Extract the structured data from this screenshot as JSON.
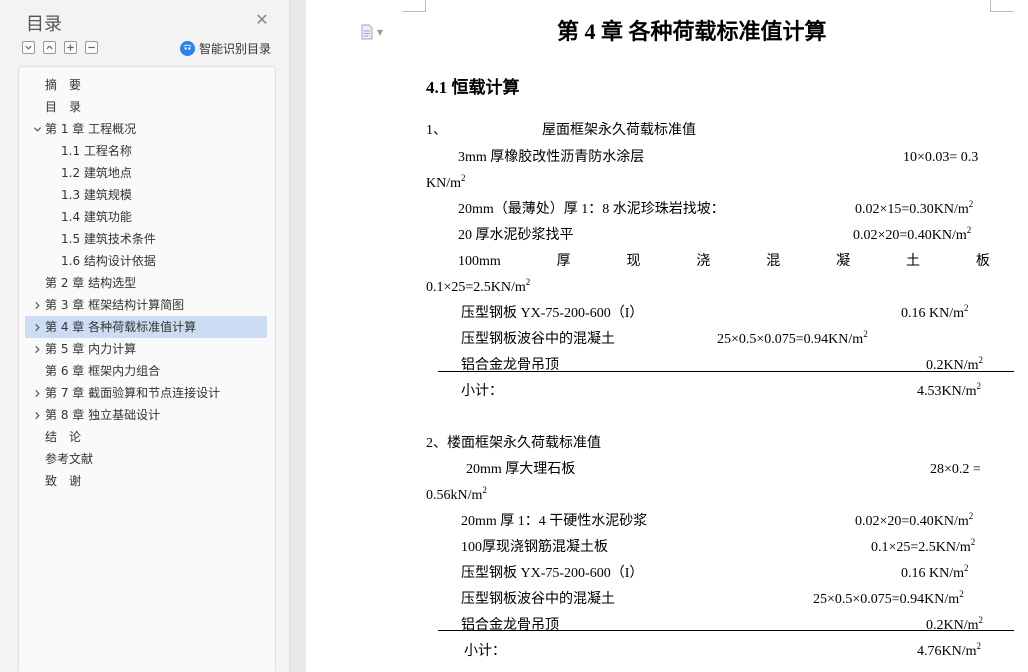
{
  "toc": {
    "title": "目录",
    "smart_label": "智能识别目录",
    "items": [
      {
        "label": "摘　要",
        "level": 0,
        "chevron": "none",
        "selected": false
      },
      {
        "label": "目　录",
        "level": 0,
        "chevron": "none",
        "selected": false
      },
      {
        "label": "第 1 章  工程概况",
        "level": 0,
        "chevron": "down",
        "selected": false
      },
      {
        "label": "1.1 工程名称",
        "level": 1,
        "chevron": "none",
        "selected": false
      },
      {
        "label": "1.2 建筑地点",
        "level": 1,
        "chevron": "none",
        "selected": false
      },
      {
        "label": "1.3 建筑规模",
        "level": 1,
        "chevron": "none",
        "selected": false
      },
      {
        "label": "1.4 建筑功能",
        "level": 1,
        "chevron": "none",
        "selected": false
      },
      {
        "label": "1.5 建筑技术条件",
        "level": 1,
        "chevron": "none",
        "selected": false
      },
      {
        "label": "1.6 结构设计依据",
        "level": 1,
        "chevron": "none",
        "selected": false
      },
      {
        "label": "第 2 章  结构选型",
        "level": 0,
        "chevron": "none",
        "selected": false
      },
      {
        "label": "第 3 章  框架结构计算简图",
        "level": 0,
        "chevron": "right",
        "selected": false
      },
      {
        "label": "第 4 章  各种荷载标准值计算",
        "level": 0,
        "chevron": "right",
        "selected": true
      },
      {
        "label": "第 5 章  内力计算",
        "level": 0,
        "chevron": "right",
        "selected": false
      },
      {
        "label": "第 6 章  框架内力组合",
        "level": 0,
        "chevron": "none",
        "selected": false
      },
      {
        "label": "第 7 章  截面验算和节点连接设计",
        "level": 0,
        "chevron": "right",
        "selected": false
      },
      {
        "label": "第 8 章  独立基础设计",
        "level": 0,
        "chevron": "right",
        "selected": false
      },
      {
        "label": "结　论",
        "level": 0,
        "chevron": "none",
        "selected": false
      },
      {
        "label": "参考文献",
        "level": 0,
        "chevron": "none",
        "selected": false
      },
      {
        "label": "致　谢",
        "level": 0,
        "chevron": "none",
        "selected": false
      }
    ]
  },
  "doc": {
    "chapter_title": "第 4 章  各种荷载标准值计算",
    "section_title": "4.1 恒载计算",
    "roof": {
      "heading_num": "1、",
      "heading_text": "屋面框架永久荷载标准值",
      "l1_name": "3mm 厚橡胶改性沥青防水涂层",
      "l1_value": "10×0.03= 0.3",
      "l1_unit": "KN/m",
      "l2_name": "20mm（最薄处）厚 1：8 水泥珍珠岩找坡：",
      "l2_value": "0.02×15=0.30KN/m",
      "l3_name": "20 厚水泥砂浆找平",
      "l3_value": "0.02×20=0.40KN/m",
      "l4_words": [
        "100mm",
        "厚",
        "现",
        "浇",
        "混",
        "凝",
        "土",
        "板"
      ],
      "l4_value": "0.1×25=2.5KN/m",
      "l5_name": "压型钢板 YX-75-200-600（I）",
      "l5_value": "0.16 KN/m",
      "l6_name": "压型钢板波谷中的混凝土",
      "l6_value": "25×0.5×0.075=0.94KN/m",
      "l7_name": "铝合金龙骨吊顶",
      "l7_value": "0.2KN/m",
      "total_label": "小计：",
      "total_value": "4.53KN/m"
    },
    "floor": {
      "heading": "2、楼面框架永久荷载标准值",
      "l1_name": "20mm 厚大理石板",
      "l1_value": "28×0.2 =",
      "l1_cont": "0.56kN/m",
      "l2_name": "20mm 厚 1：4 干硬性水泥砂浆",
      "l2_value": "0.02×20=0.40KN/m",
      "l3_name": "100厚现浇钢筋混凝土板",
      "l3_value": "0.1×25=2.5KN/m",
      "l4_name": "压型钢板 YX-75-200-600（I）",
      "l4_value": "0.16 KN/m",
      "l5_name": "压型钢板波谷中的混凝土",
      "l5_value": "25×0.5×0.075=0.94KN/m",
      "l6_name": "铝合金龙骨吊顶",
      "l6_value": "0.2KN/m",
      "total_label": "小计：",
      "total_value": "4.76KN/m"
    },
    "superscript": "2"
  }
}
